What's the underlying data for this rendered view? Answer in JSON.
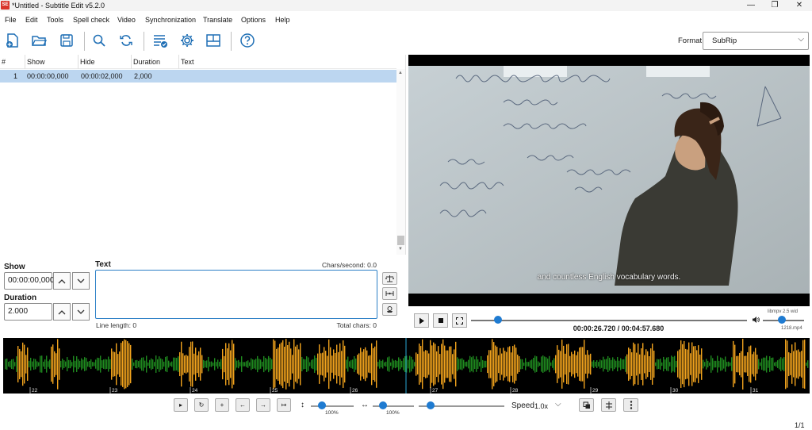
{
  "window": {
    "title": "*Untitled - Subtitle Edit v5.2.0",
    "logo": "SE",
    "minimize": "—",
    "maximize": "❐",
    "close": "✕"
  },
  "menu": [
    "File",
    "Edit",
    "Tools",
    "Spell check",
    "Video",
    "Synchronization",
    "Translate",
    "Options",
    "Help"
  ],
  "toolbar": {
    "icons": [
      "new-file-icon",
      "open-folder-icon",
      "save-icon",
      "search-icon",
      "replace-icon",
      "spell-check-icon",
      "settings-gear-icon",
      "layout-icon",
      "help-icon"
    ],
    "format_label": "Format",
    "format_value": "SubRip"
  },
  "grid": {
    "headers": [
      "#",
      "Show",
      "Hide",
      "Duration",
      "Text"
    ],
    "rows": [
      {
        "num": "1",
        "show": "00:00:00,000",
        "hide": "00:00:02,000",
        "duration": "2,000",
        "text": ""
      }
    ]
  },
  "editor": {
    "show_label": "Show",
    "show_value": "00:00:00,000",
    "duration_label": "Duration",
    "duration_value": "2.000",
    "text_label": "Text",
    "chars_per_sec": "Chars/second: 0.0",
    "line_length": "Line length:  0",
    "total_chars": "Total chars: 0"
  },
  "video": {
    "subtitle": "and countless English vocabulary words.",
    "time": "00:00:26.720 / 00:04:57.680",
    "mpv_label": "libmpv 2.5 wid",
    "file_label": "1218.mp4",
    "seek_fraction": 0.09,
    "volume_fraction": 0.45
  },
  "waveform": {
    "ticks": [
      "22",
      "23",
      "24",
      "25",
      "26",
      "27",
      "28",
      "29",
      "30",
      "31"
    ],
    "colors": {
      "background": "#000000",
      "wave": "#1f8a1f",
      "selected": "#f2a31d",
      "cursor": "#2aa7d6"
    }
  },
  "bottom": {
    "zoom_v": "100%",
    "zoom_h": "100%",
    "speed_label": "Speed",
    "speed_value": "1.0x",
    "page": "1/1"
  },
  "colors": {
    "accent": "#1f7bd1",
    "selection": "#bcd6f0"
  }
}
